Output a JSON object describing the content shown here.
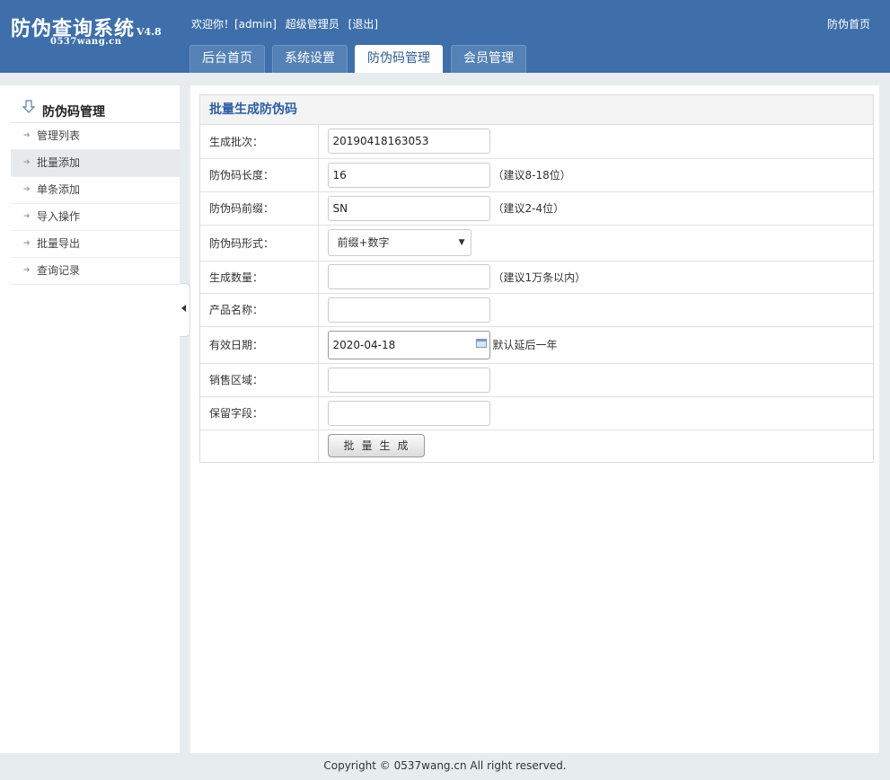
{
  "app": {
    "title": "防伪查询系统",
    "version": "V4.8",
    "domain": "0537wang.cn"
  },
  "userbar": {
    "welcome": "欢迎你！[admin]",
    "role": "超级管理员",
    "logout": "[退出]",
    "home_link": "防伪首页"
  },
  "nav": {
    "tabs": [
      {
        "label": "后台首页"
      },
      {
        "label": "系统设置"
      },
      {
        "label": "防伪码管理"
      },
      {
        "label": "会员管理"
      }
    ]
  },
  "sidebar": {
    "title": "防伪码管理",
    "items": [
      {
        "label": "管理列表"
      },
      {
        "label": "批量添加"
      },
      {
        "label": "单条添加"
      },
      {
        "label": "导入操作"
      },
      {
        "label": "批量导出"
      },
      {
        "label": "查询记录"
      }
    ]
  },
  "form": {
    "heading": "批量生成防伪码",
    "rows": {
      "batch": {
        "label": "生成批次：",
        "value": "20190418163053"
      },
      "length": {
        "label": "防伪码长度：",
        "value": "16",
        "hint": "（建议8-18位）"
      },
      "prefix": {
        "label": "防伪码前缀：",
        "value": "SN",
        "hint": "（建议2-4位）"
      },
      "format": {
        "label": "防伪码形式：",
        "value": "前缀+数字"
      },
      "count": {
        "label": "生成数量：",
        "value": "",
        "hint": "（建议1万条以内）"
      },
      "product": {
        "label": "产品名称：",
        "value": ""
      },
      "expiry": {
        "label": "有效日期：",
        "value": "2020-04-18",
        "hint": "默认延后一年"
      },
      "region": {
        "label": "销售区域：",
        "value": ""
      },
      "reserved": {
        "label": "保留字段：",
        "value": ""
      }
    },
    "submit": "批量生成"
  },
  "footer": {
    "copyright": "Copyright © 0537wang.cn All right reserved."
  }
}
